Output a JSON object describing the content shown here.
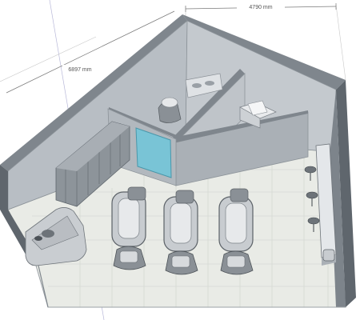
{
  "dimensions": {
    "top_width": "4790 mm",
    "left_length": "6897 mm"
  },
  "colors": {
    "floor": "#e9ebe6",
    "floor_grid": "#c9ccc6",
    "wall_top": "#7f868d",
    "wall_face": "#b8bec4",
    "wall_dark": "#5f666d",
    "glass": "#79c4d6",
    "chair": "#8a9096",
    "chair_light": "#d7dadd",
    "dim_line": "#7a7a7a"
  },
  "furniture": {
    "styling_stations": 3,
    "waiting_chairs": 3,
    "sofa": 1,
    "storage_cabinets": 5,
    "shampoo_chair": 1,
    "sinks": 2
  }
}
